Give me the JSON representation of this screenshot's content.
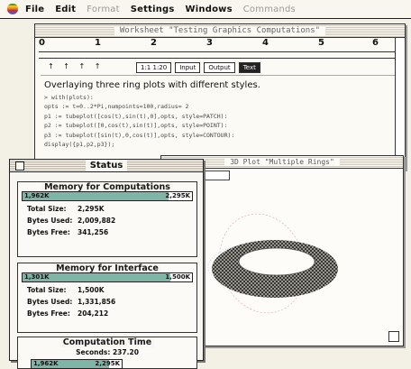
{
  "menubar": {
    "items": [
      {
        "label": "File",
        "enabled": true
      },
      {
        "label": "Edit",
        "enabled": true
      },
      {
        "label": "Format",
        "enabled": false
      },
      {
        "label": "Settings",
        "enabled": true
      },
      {
        "label": "Windows",
        "enabled": true
      },
      {
        "label": "Commands",
        "enabled": false
      }
    ]
  },
  "worksheet": {
    "title": "Worksheet \"Testing Graphics Computations\"",
    "ruler_labels": [
      "0",
      "1",
      "2",
      "3",
      "4",
      "5",
      "6"
    ],
    "tab_marks": "↑ ↑ ↑ ↑",
    "toolbar_buttons": [
      "1:1 1:20",
      "Input",
      "Output",
      "Text"
    ],
    "heading": "Overlaying three ring plots with different styles.",
    "code_lines": [
      "> with(plots):",
      "opts := t=0..2*Pi,numpoints=100,radius= 2",
      "p1 := tubeplot([cos(t),sin(t),0],opts, style=PATCH):",
      "p2 := tubeplot([0,cos(t),sin(t)],opts, style=POINT):",
      "p3 := tubeplot([sin(t),0,cos(t)],opts, style=CONTOUR):",
      "display({p1,p2,p3});"
    ]
  },
  "plot_window": {
    "title": "3D Plot \"Multiple Rings\""
  },
  "status": {
    "title": "Status",
    "memory_computations": {
      "title": "Memory for Computations",
      "bar_left": "1,962K",
      "bar_right": "2,295K",
      "fill_fraction": 0.86,
      "total_label": "Total Size:",
      "total_value": "2,295K",
      "used_label": "Bytes Used:",
      "used_value": "2,009,882",
      "free_label": "Bytes Free:",
      "free_value": "341,256"
    },
    "memory_interface": {
      "title": "Memory for Interface",
      "bar_left": "1,301K",
      "bar_right": "1,500K",
      "fill_fraction": 0.87,
      "total_label": "Total Size:",
      "total_value": "1,500K",
      "used_label": "Bytes Used:",
      "used_value": "1,331,856",
      "free_label": "Bytes Free:",
      "free_value": "204,212"
    },
    "computation_time": {
      "title": "Computation Time",
      "label": "Seconds:",
      "value": "237.20"
    }
  },
  "bottom_bar": {
    "left": "1,962K",
    "right": "2,295K",
    "fill_fraction": 0.86
  },
  "colors": {
    "bar_fill": "#7fb5a7",
    "ring_dark": "#1c1c1c",
    "ring_light": "#e8e4d8"
  }
}
